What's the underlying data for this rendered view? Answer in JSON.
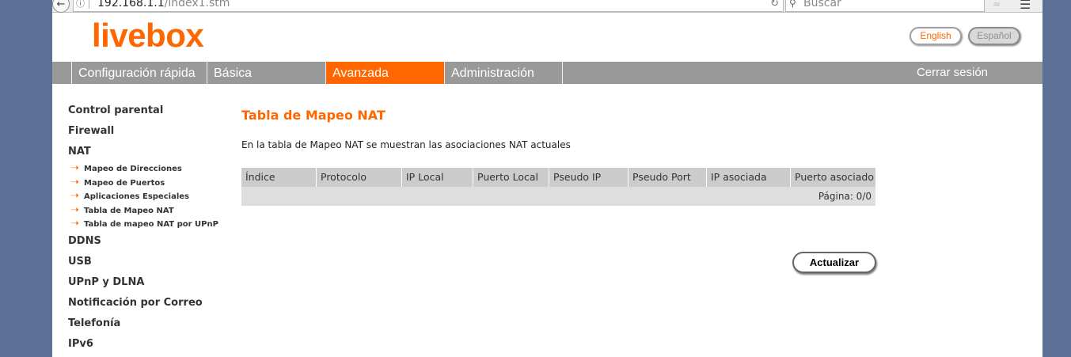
{
  "browser": {
    "url_host": "192.168.1.1",
    "url_path": "/index1.stm",
    "search_placeholder": "Buscar"
  },
  "header": {
    "logo": "livebox",
    "lang_english": "English",
    "lang_spanish": "Español"
  },
  "nav": {
    "items": [
      "Configuración rápida",
      "Básica",
      "Avanzada",
      "Administración"
    ],
    "active": "Avanzada",
    "logout": "Cerrar sesión"
  },
  "sidebar": {
    "items": [
      "Control parental",
      "Firewall",
      "NAT"
    ],
    "nat_sub": [
      "Mapeo de Direcciones",
      "Mapeo de Puertos",
      "Aplicaciones Especiales",
      "Tabla de Mapeo NAT",
      "Tabla de mapeo NAT por UPnP"
    ],
    "items_after": [
      "DDNS",
      "USB",
      "UPnP y DLNA",
      "Notificación por Correo",
      "Telefonía",
      "IPv6"
    ]
  },
  "main": {
    "title": "Tabla de Mapeo NAT",
    "description": "En la tabla de Mapeo NAT se muestran las asociaciones NAT actuales",
    "columns": [
      "Índice",
      "Protocolo",
      "IP Local",
      "Puerto Local",
      "Pseudo IP",
      "Pseudo Port",
      "IP asociada",
      "Puerto asociado"
    ],
    "rows": [],
    "page_info": "Página: 0/0",
    "update_button": "Actualizar"
  },
  "colors": {
    "accent": "#ff6600",
    "nav_bg": "#999999",
    "table_header": "#cccccc"
  }
}
